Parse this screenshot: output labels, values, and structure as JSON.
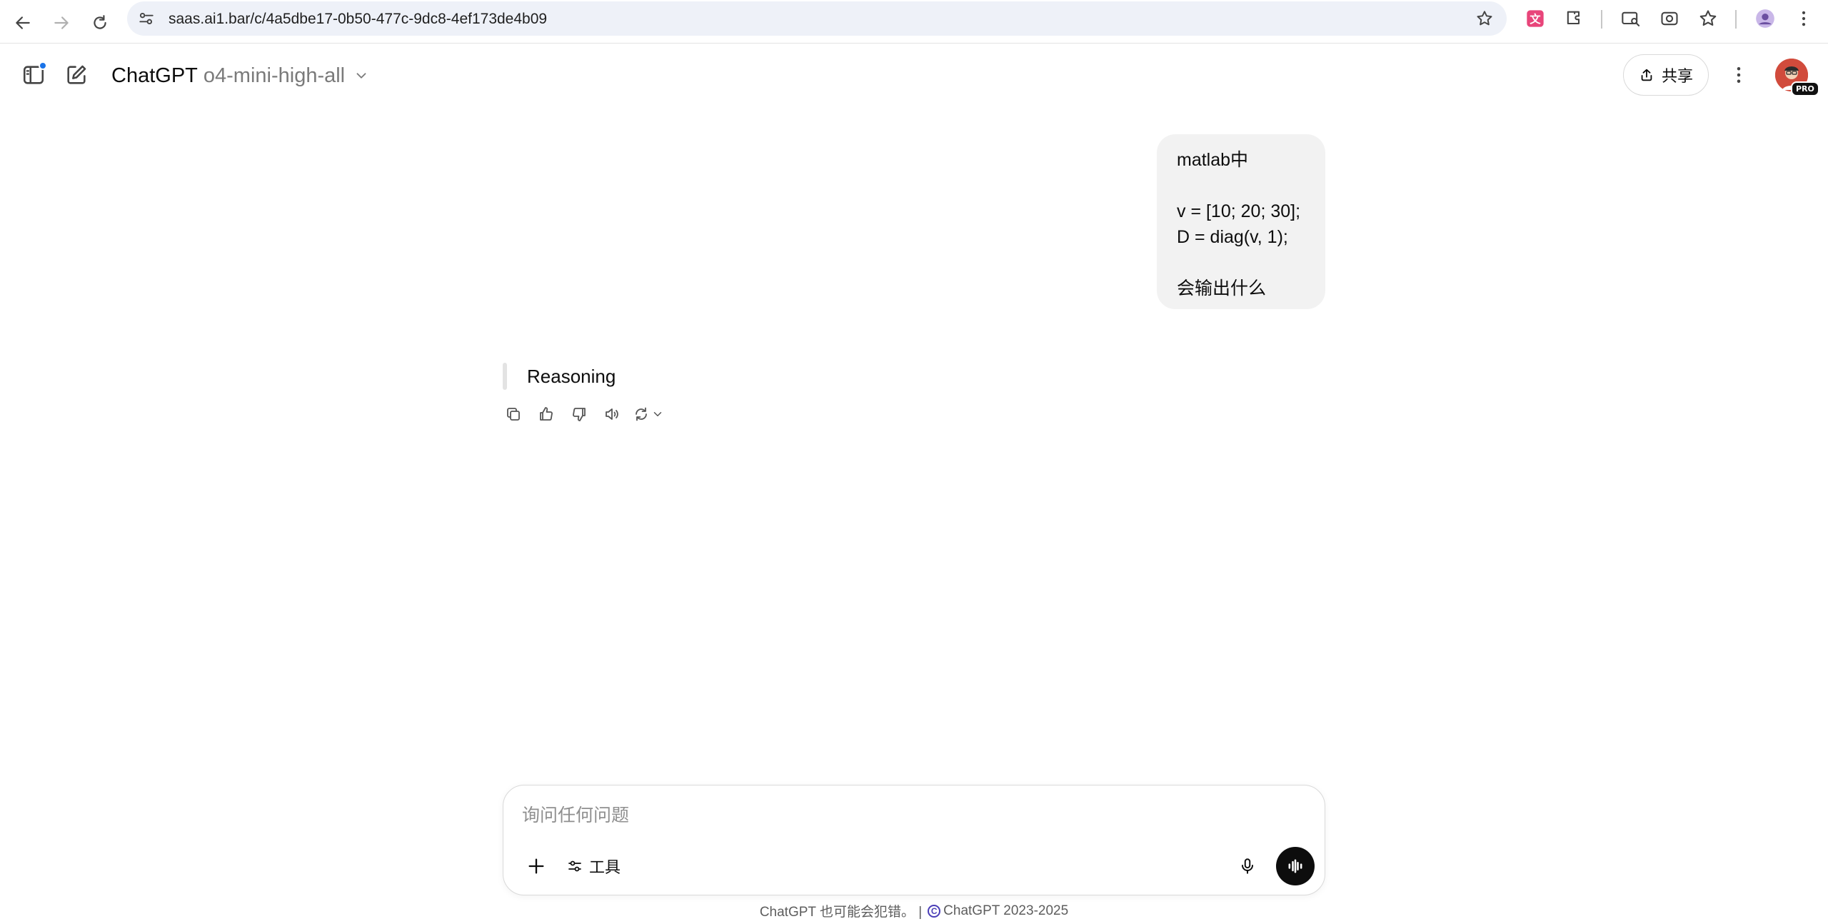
{
  "browser": {
    "url": "saas.ai1.bar/c/4a5dbe17-0b50-477c-9dc8-4ef173de4b09",
    "icons": [
      "back-icon",
      "forward-icon",
      "reload-icon",
      "site-settings-icon",
      "bookmark-star-icon",
      "translate-extension-icon",
      "extensions-puzzle-icon",
      "tab-search-icon",
      "screenshot-icon",
      "bookmarks-icon",
      "profile-avatar-icon",
      "browser-menu-icon"
    ]
  },
  "header": {
    "brand": "ChatGPT",
    "model": "o4-mini-high-all",
    "share_label": "共享",
    "avatar_badge": "PRO"
  },
  "conversation": {
    "user_message_lines": [
      "matlab中",
      "",
      "v = [10; 20; 30];",
      "D = diag(v, 1);",
      "",
      "会输出什么"
    ],
    "reasoning_label": "Reasoning",
    "actions": [
      "copy-icon",
      "thumbs-up-icon",
      "thumbs-down-icon",
      "read-aloud-icon",
      "regenerate-icon"
    ]
  },
  "composer": {
    "placeholder": "询问任何问题",
    "tools_label": "工具"
  },
  "footer": {
    "disclaimer": "ChatGPT 也可能会犯错。 |",
    "copyright": "ChatGPT 2023-2025"
  },
  "colors": {
    "accent_blue": "#1a73e8",
    "bubble_bg": "#f2f2f2",
    "avatar_bg": "#d14b3c",
    "text": "#0d0d0d"
  }
}
